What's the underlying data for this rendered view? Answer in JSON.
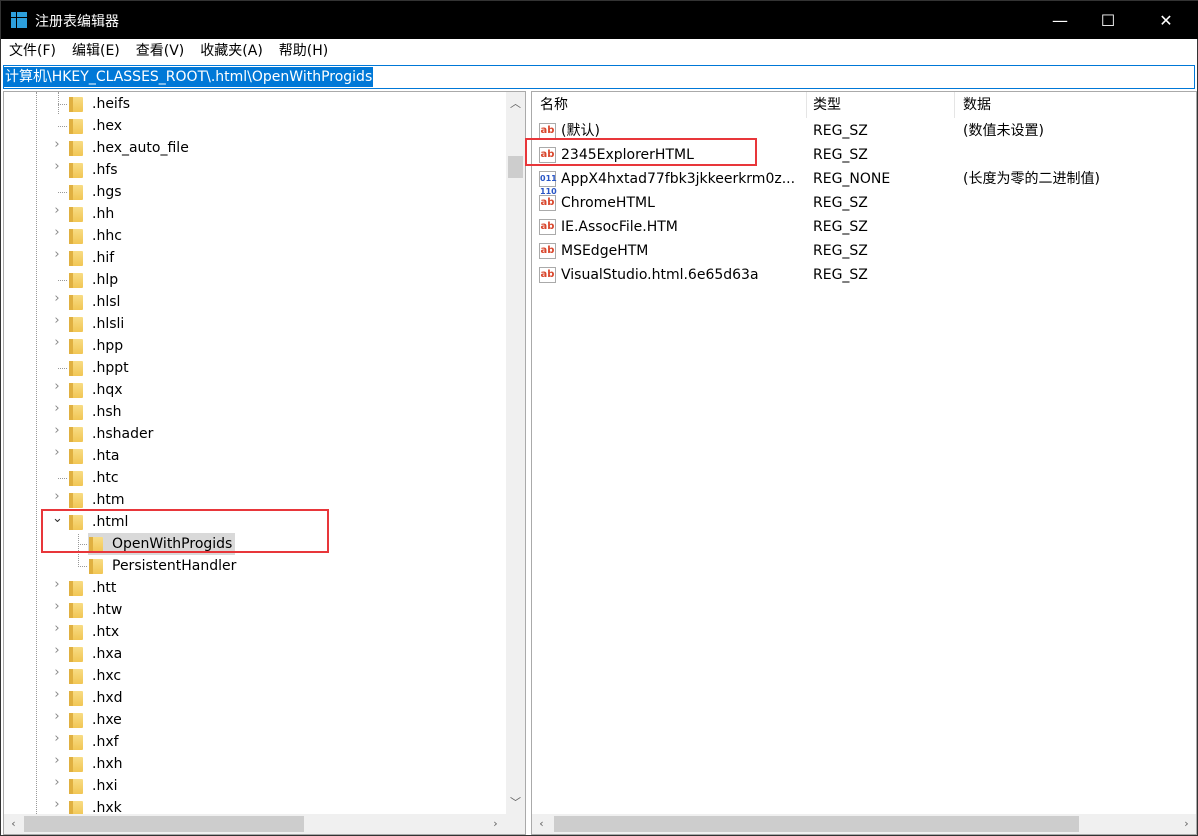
{
  "window": {
    "title": "注册表编辑器",
    "minimize": "—",
    "maximize": "☐",
    "close": "✕"
  },
  "menu": [
    "文件(F)",
    "编辑(E)",
    "查看(V)",
    "收藏夹(A)",
    "帮助(H)"
  ],
  "address": "计算机\\HKEY_CLASSES_ROOT\\.html\\OpenWithProgids",
  "tree": [
    {
      "label": ".heifs",
      "expandable": false
    },
    {
      "label": ".hex",
      "expandable": false
    },
    {
      "label": ".hex_auto_file",
      "expandable": true
    },
    {
      "label": ".hfs",
      "expandable": true
    },
    {
      "label": ".hgs",
      "expandable": false
    },
    {
      "label": ".hh",
      "expandable": true
    },
    {
      "label": ".hhc",
      "expandable": true
    },
    {
      "label": ".hif",
      "expandable": true
    },
    {
      "label": ".hlp",
      "expandable": false
    },
    {
      "label": ".hlsl",
      "expandable": true
    },
    {
      "label": ".hlsli",
      "expandable": true
    },
    {
      "label": ".hpp",
      "expandable": true
    },
    {
      "label": ".hppt",
      "expandable": false
    },
    {
      "label": ".hqx",
      "expandable": true
    },
    {
      "label": ".hsh",
      "expandable": true
    },
    {
      "label": ".hshader",
      "expandable": true
    },
    {
      "label": ".hta",
      "expandable": true
    },
    {
      "label": ".htc",
      "expandable": false
    },
    {
      "label": ".htm",
      "expandable": true
    },
    {
      "label": ".html",
      "expandable": true,
      "expanded": true
    },
    {
      "label": "OpenWithProgids",
      "level": 2,
      "selected": true
    },
    {
      "label": "PersistentHandler",
      "level": 2
    },
    {
      "label": ".htt",
      "expandable": true
    },
    {
      "label": ".htw",
      "expandable": true
    },
    {
      "label": ".htx",
      "expandable": true
    },
    {
      "label": ".hxa",
      "expandable": true
    },
    {
      "label": ".hxc",
      "expandable": true
    },
    {
      "label": ".hxd",
      "expandable": true
    },
    {
      "label": ".hxe",
      "expandable": true
    },
    {
      "label": ".hxf",
      "expandable": true
    },
    {
      "label": ".hxh",
      "expandable": true
    },
    {
      "label": ".hxi",
      "expandable": true
    },
    {
      "label": ".hxk",
      "expandable": true
    }
  ],
  "columns": {
    "name": "名称",
    "type": "类型",
    "data": "数据"
  },
  "values": [
    {
      "name": "(默认)",
      "type": "REG_SZ",
      "data": "(数值未设置)",
      "icon": "string"
    },
    {
      "name": "2345ExplorerHTML",
      "type": "REG_SZ",
      "data": "",
      "icon": "string"
    },
    {
      "name": "AppX4hxtad77fbk3jkkeerkrm0z...",
      "type": "REG_NONE",
      "data": "(长度为零的二进制值)",
      "icon": "binary"
    },
    {
      "name": "ChromeHTML",
      "type": "REG_SZ",
      "data": "",
      "icon": "string"
    },
    {
      "name": "IE.AssocFile.HTM",
      "type": "REG_SZ",
      "data": "",
      "icon": "string"
    },
    {
      "name": "MSEdgeHTM",
      "type": "REG_SZ",
      "data": "",
      "icon": "string"
    },
    {
      "name": "VisualStudio.html.6e65d63a",
      "type": "REG_SZ",
      "data": "",
      "icon": "string"
    }
  ],
  "colors": {
    "highlight_box": "#e8363a",
    "selection": "#0078d7",
    "folder": "#f1c654"
  }
}
